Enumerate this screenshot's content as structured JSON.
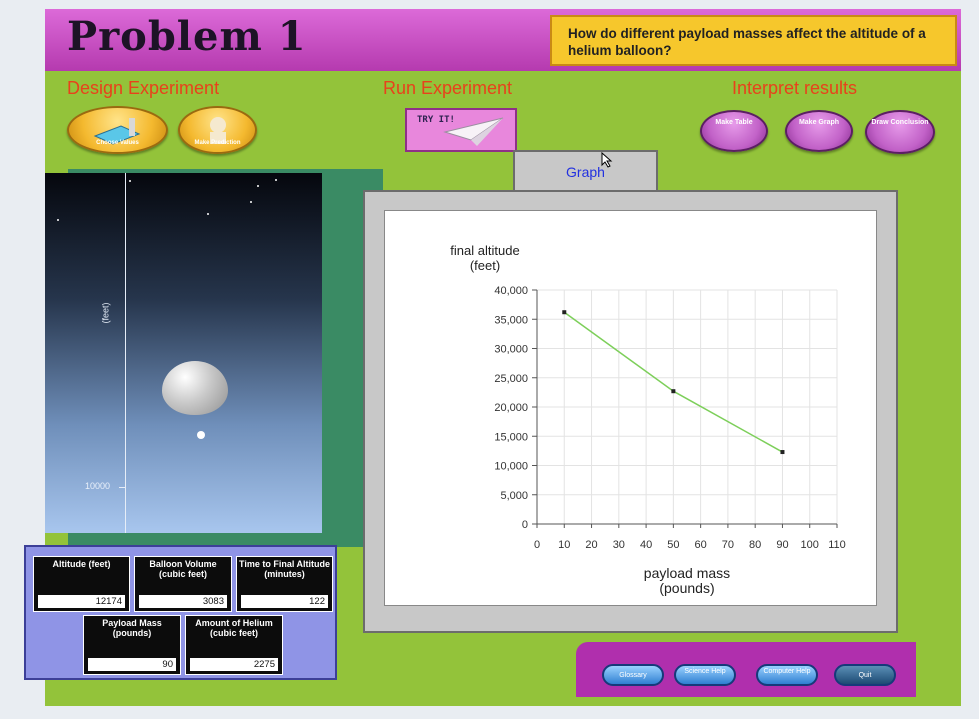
{
  "header": {
    "title": "Problem 1",
    "question": "How do different payload masses affect the altitude of a helium balloon?"
  },
  "sections": {
    "design": "Design  Experiment",
    "run": "Run  Experiment",
    "interpret": "Interpret results"
  },
  "design_buttons": {
    "choose_values": "Choose Values",
    "make_prediction": "Make Prediction"
  },
  "run_button": {
    "label": "TRY IT!"
  },
  "interpret_buttons": {
    "make_table": "Make Table",
    "make_graph": "Make Graph",
    "draw_conclusion": "Draw Conclusion"
  },
  "simulation": {
    "axis_unit": "(feet)",
    "tick_label": "10000"
  },
  "readouts": {
    "altitude": {
      "label": "Altitude (feet)",
      "value": "12174"
    },
    "balloon_volume": {
      "label": "Balloon Volume (cubic feet)",
      "value": "3083"
    },
    "time_to_final": {
      "label": "Time to Final Altitude (minutes)",
      "value": "122"
    },
    "payload_mass": {
      "label": "Payload Mass (pounds)",
      "value": "90"
    },
    "helium_amount": {
      "label": "Amount of Helium (cubic feet)",
      "value": "2275"
    }
  },
  "graph_tab": {
    "label": "Graph"
  },
  "chart_data": {
    "type": "line",
    "ylabel": "final altitude (feet)",
    "xlabel": "payload mass (pounds)",
    "xlim": [
      0,
      110
    ],
    "ylim": [
      0,
      40000
    ],
    "xticks": [
      "0",
      "10",
      "20",
      "30",
      "40",
      "50",
      "60",
      "70",
      "80",
      "90",
      "100",
      "110"
    ],
    "yticks": [
      "0",
      "5,000",
      "10,000",
      "15,000",
      "20,000",
      "25,000",
      "30,000",
      "35,000",
      "40,000"
    ],
    "grid": true,
    "series": [
      {
        "points": [
          [
            10,
            36200
          ],
          [
            50,
            22700
          ],
          [
            90,
            12300
          ]
        ],
        "color": "#7dcf5a"
      }
    ]
  },
  "bottom_nav": {
    "glossary": "Glossary",
    "science_help": "Science Help",
    "computer_help": "Computer Help",
    "quit": "Quit"
  }
}
